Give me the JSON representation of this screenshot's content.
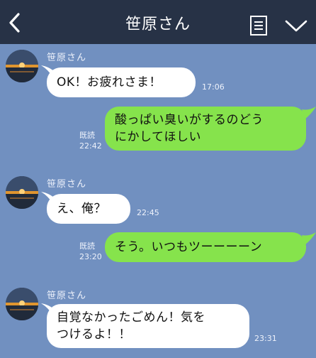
{
  "header": {
    "title": "笹原さん",
    "back_icon": "chevron-left-icon",
    "menu_icon": "notes-icon",
    "expand_icon": "chevron-down-icon"
  },
  "colors": {
    "header_bg": "#273246",
    "chat_bg": "#7190c0",
    "incoming_bubble": "#ffffff",
    "outgoing_bubble": "#86e34c"
  },
  "messages": [
    {
      "direction": "in",
      "sender": "笹原さん",
      "lines": [
        "OK！お疲れさま！"
      ],
      "time": "17:06"
    },
    {
      "direction": "out",
      "lines": [
        "酸っぱい臭いがするのどう",
        "にかしてほしい"
      ],
      "read": "既読",
      "time": "22:42"
    },
    {
      "direction": "in",
      "sender": "笹原さん",
      "lines": [
        "え、俺？"
      ],
      "time": "22:45"
    },
    {
      "direction": "out",
      "lines": [
        "そう。いつもツーーーーン"
      ],
      "read": "既読",
      "time": "23:20"
    },
    {
      "direction": "in",
      "sender": "笹原さん",
      "lines": [
        "自覚なかったごめん！気を",
        "つけるよ！！"
      ],
      "time": "23:31"
    }
  ]
}
